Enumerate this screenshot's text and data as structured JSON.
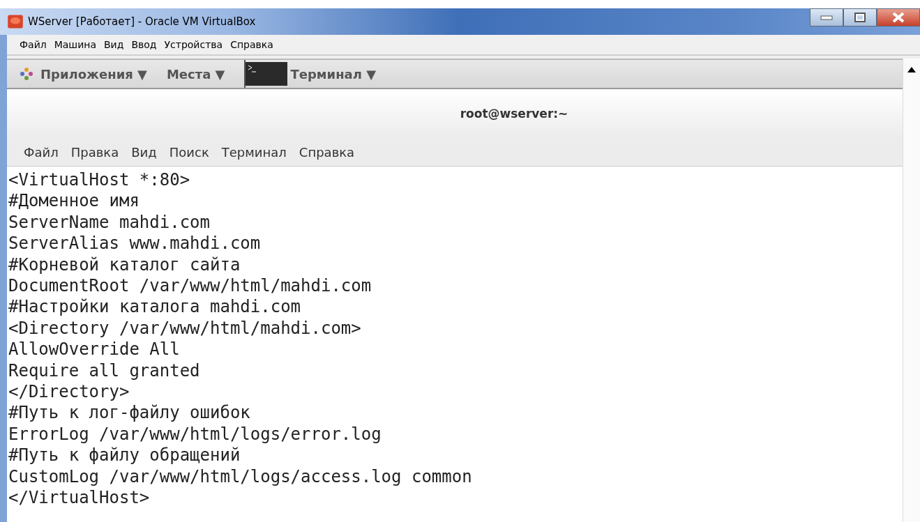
{
  "window": {
    "title": "WServer [Работает] - Oracle VM VirtualBox"
  },
  "menu_bar": [
    "Файл",
    "Машина",
    "Вид",
    "Ввод",
    "Устройства",
    "Справка"
  ],
  "panel": {
    "items": [
      {
        "label": "Приложения ▼",
        "kind": "apps"
      },
      {
        "label": "Места ▼",
        "kind": "places"
      },
      {
        "label": "Терминал ▼",
        "kind": "terminal"
      }
    ]
  },
  "terminal": {
    "title": "root@wserver:~",
    "menu": [
      "Файл",
      "Правка",
      "Вид",
      "Поиск",
      "Терминал",
      "Справка"
    ],
    "lines": [
      "<VirtualHost *:80>",
      "#Доменное имя",
      "ServerName mahdi.com",
      "ServerAlias www.mahdi.com",
      "#Корневой каталог сайта",
      "DocumentRoot /var/www/html/mahdi.com",
      "#Настройки каталога mahdi.com",
      "<Directory /var/www/html/mahdi.com>",
      "AllowOverride All",
      "Require all granted",
      "</Directory>",
      "#Путь к лог-файлу ошибок",
      "ErrorLog /var/www/html/logs/error.log",
      "#Путь к файлу обращений",
      "CustomLog /var/www/html/logs/access.log common",
      "</VirtualHost>"
    ]
  }
}
